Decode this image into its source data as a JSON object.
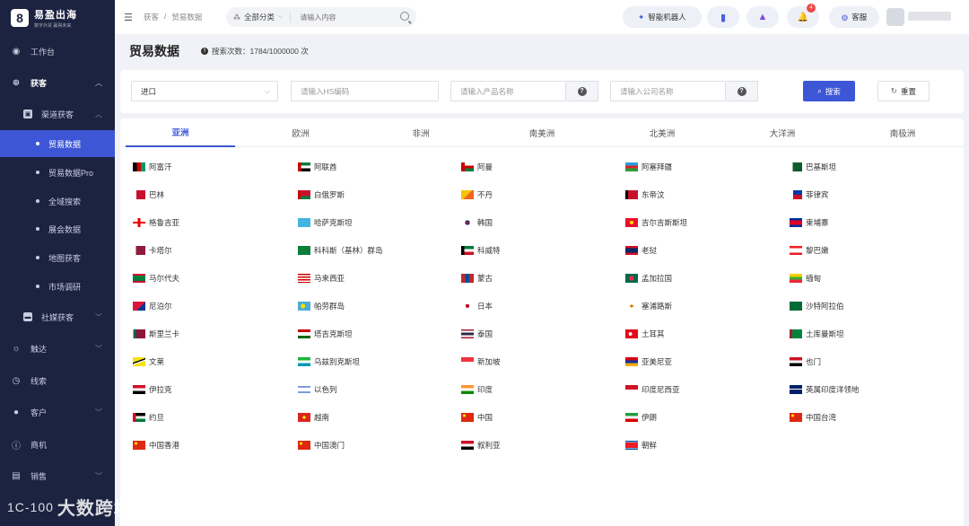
{
  "brand": {
    "logo_glyph": "8",
    "title": "易盈出海",
    "subtitle": "数字外贸 赢得未来"
  },
  "sidebar": {
    "items": [
      {
        "label": "工作台",
        "icon": "dashboard-icon",
        "glyph": "◉"
      },
      {
        "label": "获客",
        "icon": "globe-icon",
        "glyph": "⊕"
      },
      {
        "label": "渠道获客",
        "icon": "channel-icon",
        "glyph": "▣"
      },
      {
        "label": "贸易数据"
      },
      {
        "label": "贸易数据Pro"
      },
      {
        "label": "全域搜索"
      },
      {
        "label": "展会数据"
      },
      {
        "label": "地图获客"
      },
      {
        "label": "市场调研"
      },
      {
        "label": "社媒获客",
        "icon": "chat-icon",
        "glyph": "▬"
      },
      {
        "label": "触达",
        "icon": "bulb-icon",
        "glyph": "☼"
      },
      {
        "label": "线索",
        "icon": "compass-icon",
        "glyph": "◷"
      },
      {
        "label": "客户",
        "icon": "user-icon",
        "glyph": "●"
      },
      {
        "label": "商机",
        "icon": "info-icon",
        "glyph": "ⓘ"
      },
      {
        "label": "销售",
        "icon": "document-icon",
        "glyph": "▤"
      }
    ]
  },
  "topbar": {
    "menu_glyph": "☰",
    "breadcrumb": [
      "获客",
      "/",
      "贸易数据"
    ],
    "category": "全部分类",
    "category_caret": "⌵",
    "search_placeholder": "请输入内容",
    "ai_label": "智能机器人",
    "ai_glyph": "✦",
    "book_glyph": "▮",
    "a_glyph": "▲",
    "bell_glyph": "🔔",
    "notification_count": "4",
    "service_label": "客服",
    "service_glyph": "◍"
  },
  "page": {
    "title": "贸易数据",
    "info_glyph": "!",
    "search_count": "搜索次数：1784/1000000 次"
  },
  "filters": {
    "trade_type": "进口",
    "select_caret": "⌵",
    "hs_placeholder": "请输入HS编码",
    "product_placeholder": "请输入产品名称",
    "company_placeholder": "请输入公司名称",
    "help_glyph": "?",
    "search_label": "搜索",
    "search_glyph": "⌕",
    "reset_label": "重置",
    "reset_glyph": "↻"
  },
  "tabs": [
    "亚洲",
    "欧洲",
    "非洲",
    "南美洲",
    "北美洲",
    "大洋洲",
    "南极洲"
  ],
  "countries": [
    "阿富汗",
    "阿联酋",
    "阿曼",
    "阿塞拜疆",
    "巴基斯坦",
    "巴林",
    "白俄罗斯",
    "不丹",
    "东帝汶",
    "菲律宾",
    "格鲁吉亚",
    "哈萨克斯坦",
    "韩国",
    "吉尔吉斯斯坦",
    "柬埔寨",
    "卡塔尔",
    "科科斯（基林）群岛",
    "科威特",
    "老挝",
    "黎巴嫩",
    "马尔代夫",
    "马来西亚",
    "蒙古",
    "孟加拉国",
    "缅甸",
    "尼泊尔",
    "帕劳群岛",
    "日本",
    "塞浦路斯",
    "沙特阿拉伯",
    "斯里兰卡",
    "塔吉克斯坦",
    "泰国",
    "土耳其",
    "土库曼斯坦",
    "文莱",
    "乌兹别克斯坦",
    "新加坡",
    "亚美尼亚",
    "也门",
    "伊拉克",
    "以色列",
    "印度",
    "印度尼西亚",
    "英属印度洋领地",
    "约旦",
    "越南",
    "中国",
    "伊朗",
    "中国台湾",
    "中国香港",
    "中国澳门",
    "叙利亚",
    "朝鲜"
  ],
  "watermark": {
    "mark": "1C-100",
    "text": "大数跨境"
  }
}
